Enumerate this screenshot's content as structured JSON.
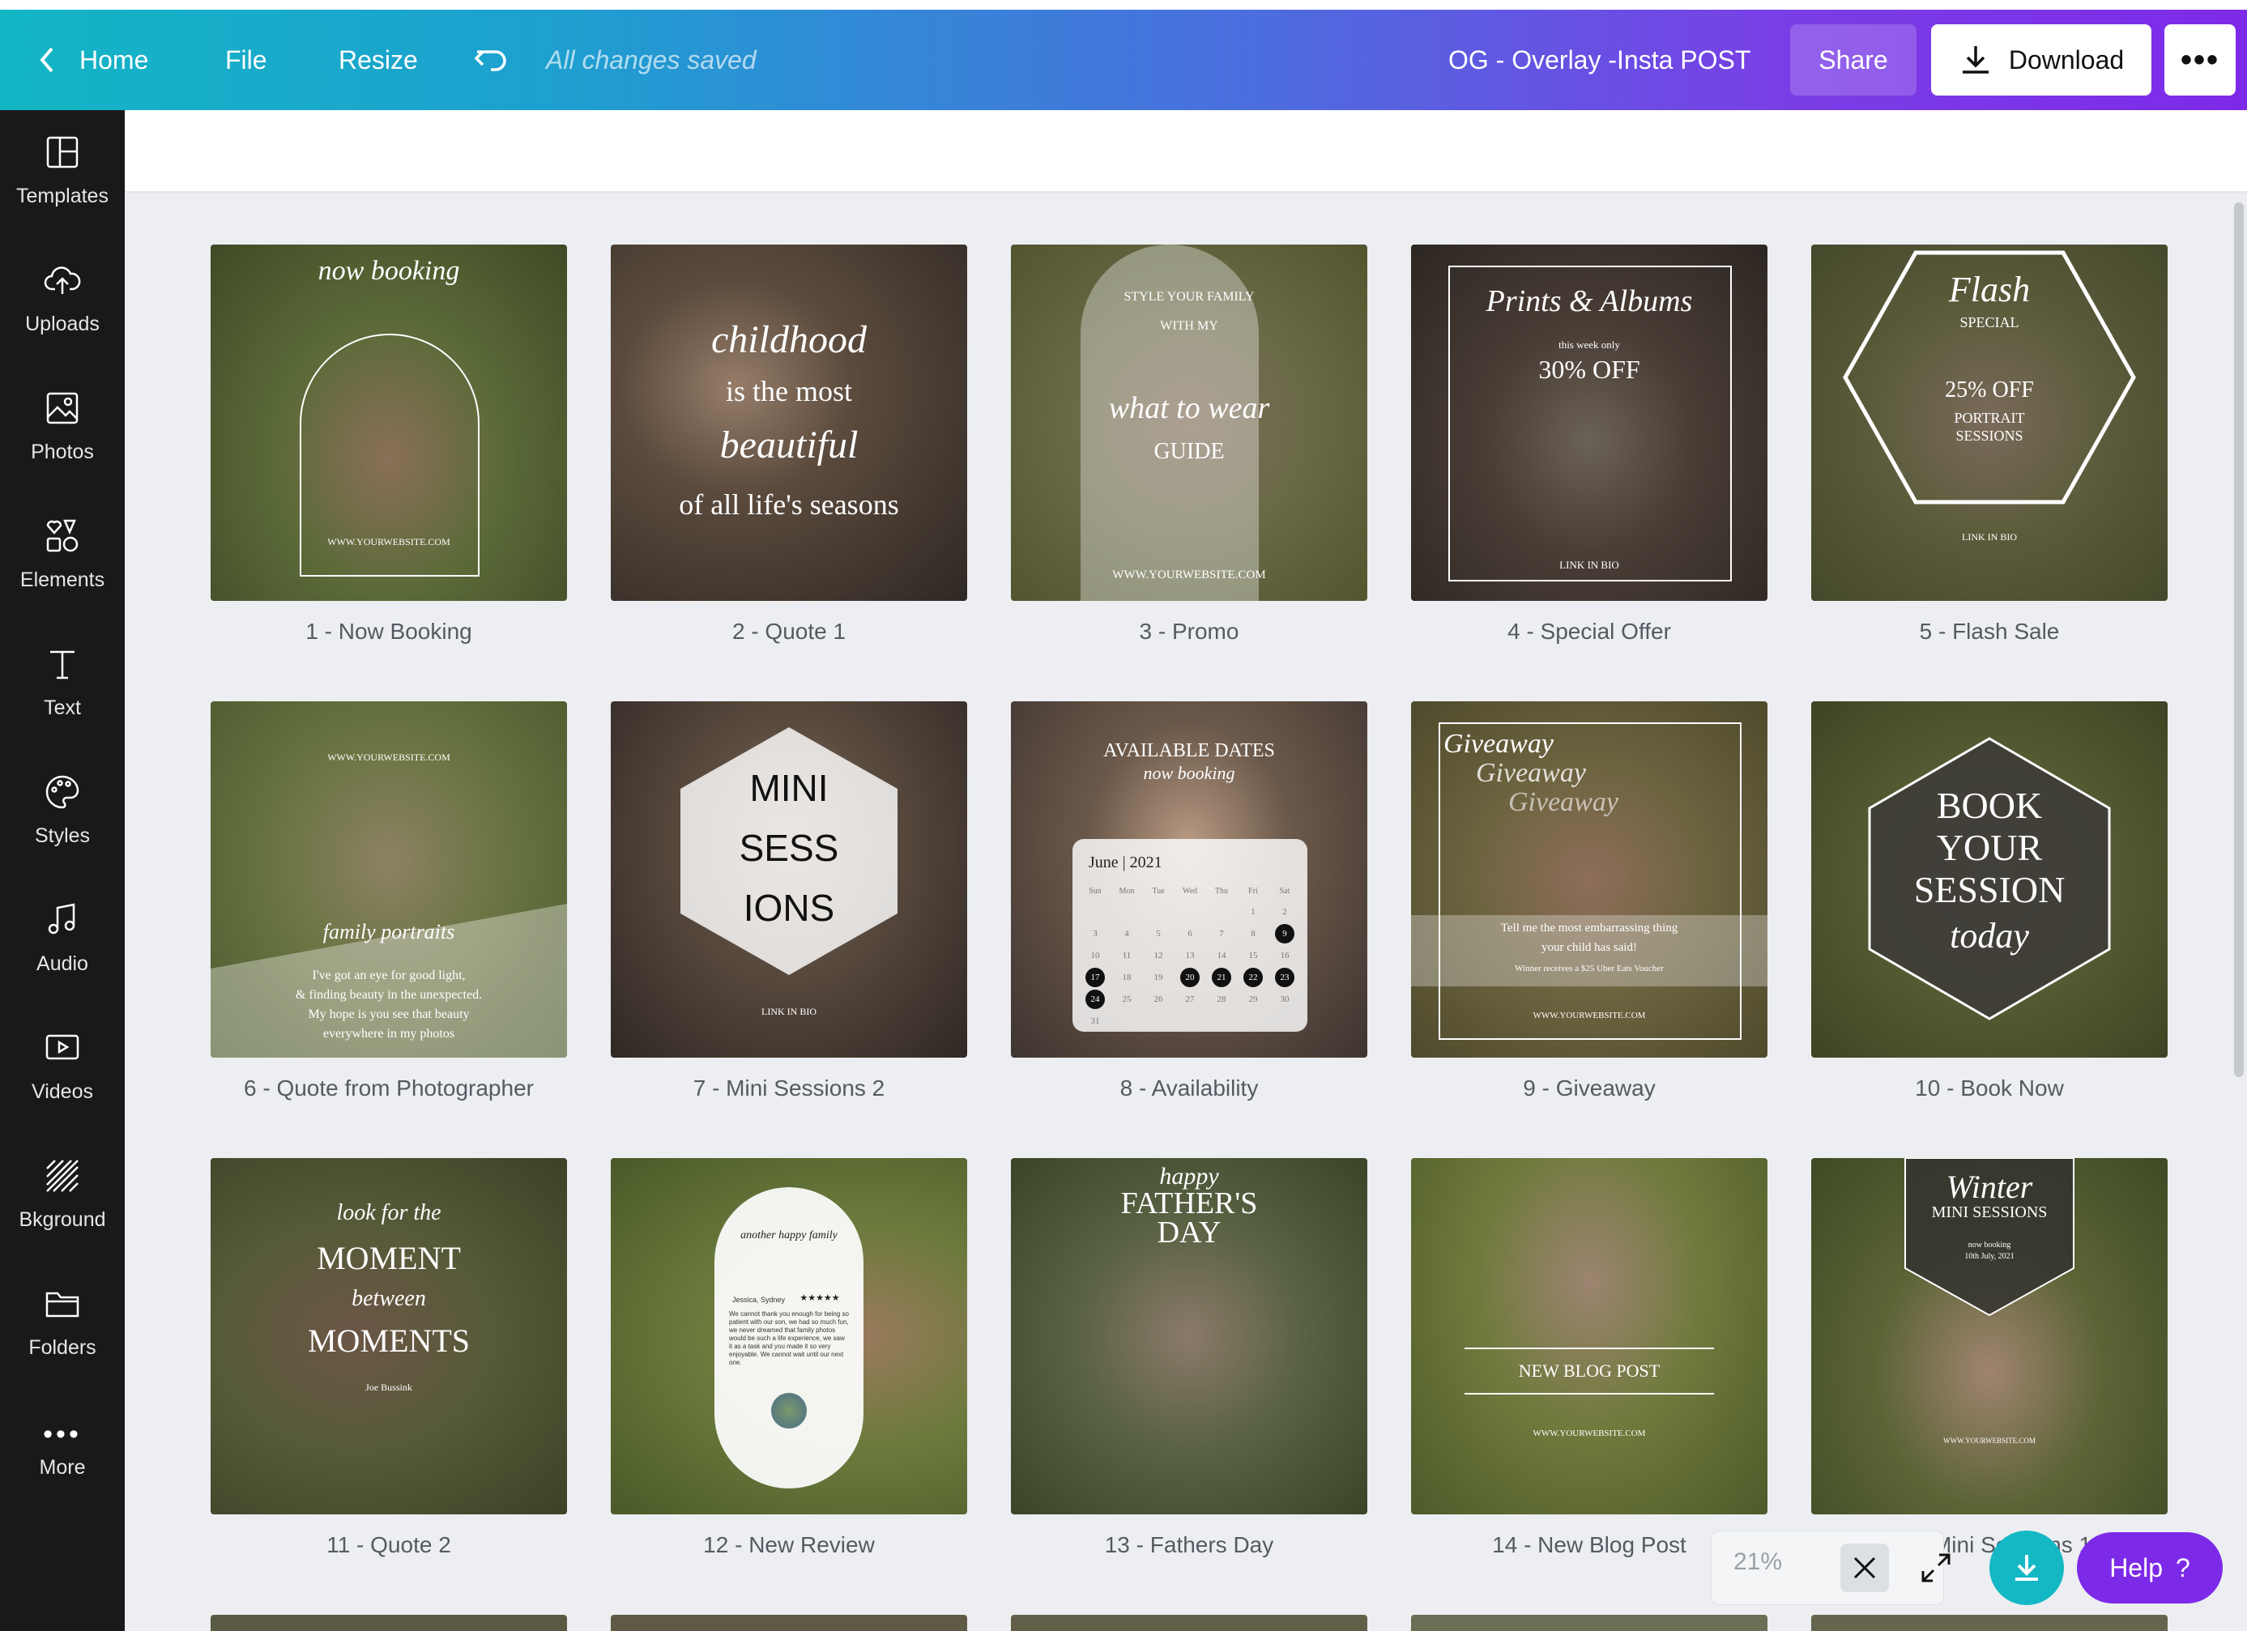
{
  "topbar": {
    "home_label": "Home",
    "file_label": "File",
    "resize_label": "Resize",
    "saved_status": "All changes saved",
    "doc_title": "OG - Overlay -Insta POST",
    "share_label": "Share",
    "download_label": "Download"
  },
  "sidebar": {
    "items": [
      {
        "label": "Templates",
        "icon": "templates-icon"
      },
      {
        "label": "Uploads",
        "icon": "upload-cloud-icon"
      },
      {
        "label": "Photos",
        "icon": "photo-icon"
      },
      {
        "label": "Elements",
        "icon": "elements-icon"
      },
      {
        "label": "Text",
        "icon": "text-icon"
      },
      {
        "label": "Styles",
        "icon": "palette-icon"
      },
      {
        "label": "Audio",
        "icon": "music-note-icon"
      },
      {
        "label": "Videos",
        "icon": "video-icon"
      },
      {
        "label": "Bkground",
        "icon": "background-pattern-icon"
      },
      {
        "label": "Folders",
        "icon": "folder-icon"
      },
      {
        "label": "More",
        "icon": "more-dots-icon"
      }
    ]
  },
  "pages": [
    {
      "label": "1 - Now Booking",
      "t1": "now booking",
      "t2": "WWW.YOURWEBSITE.COM",
      "bg": "#5d6b3a"
    },
    {
      "label": "2 - Quote 1",
      "t1": "childhood",
      "t2": "is the most",
      "t3": "beautiful",
      "t4": "of all life's seasons",
      "bg": "#4a4238"
    },
    {
      "label": "3 - Promo",
      "t1": "STYLE YOUR FAMILY",
      "t2": "WITH MY",
      "t3": "what to wear",
      "t4": "GUIDE",
      "t5": "WWW.YOURWEBSITE.COM",
      "bg": "#6a6a4a"
    },
    {
      "label": "4 - Special Offer",
      "t1": "Prints & Albums",
      "t2": "this week only",
      "t3": "30% OFF",
      "t4": "LINK IN BIO",
      "bg": "#3d342c"
    },
    {
      "label": "5 - Flash Sale",
      "t1": "Flash",
      "t2": "SPECIAL",
      "t3": "25% OFF",
      "t4": "PORTRAIT",
      "t5": "SESSIONS",
      "t6": "LINK IN BIO",
      "bg": "#5a5a3c"
    },
    {
      "label": "6 - Quote from Photographer",
      "t1": "WWW.YOURWEBSITE.COM",
      "t2": "family portraits",
      "t3": "I've got an eye for good light,",
      "t4": "& finding beauty in the unexpected.",
      "t5": "My hope is you see that beauty",
      "t6": "everywhere in my photos",
      "bg": "#667040"
    },
    {
      "label": "7 - Mini Sessions 2",
      "t1": "MINI",
      "t2": "SESS",
      "t3": "IONS",
      "t4": "LINK IN BIO",
      "bg": "#4c4036"
    },
    {
      "label": "8 - Availability",
      "t1": "AVAILABLE DATES",
      "t2": "now booking",
      "t3": "June | 2021",
      "bg": "#5b4e44"
    },
    {
      "label": "9 - Giveaway",
      "t1": "Giveaway",
      "t2": "Giveaway",
      "t3": "Giveaway",
      "t4": "Tell me the most embarrassing thing",
      "t5": "your child has said!",
      "t6": "Winner receives a $25 Uber Eats Voucher",
      "t7": "WWW.YOURWEBSITE.COM",
      "bg": "#6d6440"
    },
    {
      "label": "10 - Book Now",
      "t1": "BOOK",
      "t2": "YOUR",
      "t3": "SESSION",
      "t4": "today",
      "bg": "#585c34"
    },
    {
      "label": "11 - Quote 2",
      "t1": "look for the",
      "t2": "MOMENT",
      "t3": "between",
      "t4": "MOMENTS",
      "t5": "Joe Bussink",
      "bg": "#565a38"
    },
    {
      "label": "12 - New Review",
      "t1": "another happy family",
      "t2": "Jessica, Sydney",
      "t3": "★★★★★",
      "t4": "We cannot thank you enough for being so patient with our son, we had so much fun, we never dreamed that family photos would be such a life experience, we saw it as a task and you made it so very enjoyable. We cannot wait until our next one.",
      "bg": "#6b7a3c"
    },
    {
      "label": "13 - Fathers Day",
      "t1": "happy",
      "t2": "FATHER'S",
      "t3": "DAY",
      "bg": "#5a6244"
    },
    {
      "label": "14 - New Blog Post",
      "t1": "NEW BLOG POST",
      "t2": "WWW.YOURWEBSITE.COM",
      "bg": "#6f7a3c"
    },
    {
      "label": "15 - Mini Sessions 1",
      "t1": "Winter",
      "t2": "MINI SESSIONS",
      "t3": "now booking",
      "t4": "10th July, 2021",
      "t5": "WWW.YOURWEBSITE.COM",
      "bg": "#4e5a30"
    }
  ],
  "calendar": {
    "days": [
      "Sun",
      "Mon",
      "Tue",
      "Wed",
      "Thu",
      "Fri",
      "Sat"
    ],
    "rows": [
      [
        "",
        "",
        "",
        "",
        "",
        "1",
        "2"
      ],
      [
        "3",
        "4",
        "5",
        "6",
        "7",
        "8",
        "9"
      ],
      [
        "10",
        "11",
        "12",
        "13",
        "14",
        "15",
        "16"
      ],
      [
        "17",
        "18",
        "19",
        "20",
        "21",
        "22",
        "23"
      ],
      [
        "24",
        "25",
        "26",
        "27",
        "28",
        "29",
        "30"
      ],
      [
        "31",
        "",
        "",
        "",
        "",
        "",
        ""
      ]
    ],
    "highlighted": [
      "9",
      "17",
      "20",
      "21",
      "22",
      "23",
      "24"
    ]
  },
  "zoom": {
    "level": "21%"
  },
  "help": {
    "label": "Help",
    "glyph": "?"
  }
}
